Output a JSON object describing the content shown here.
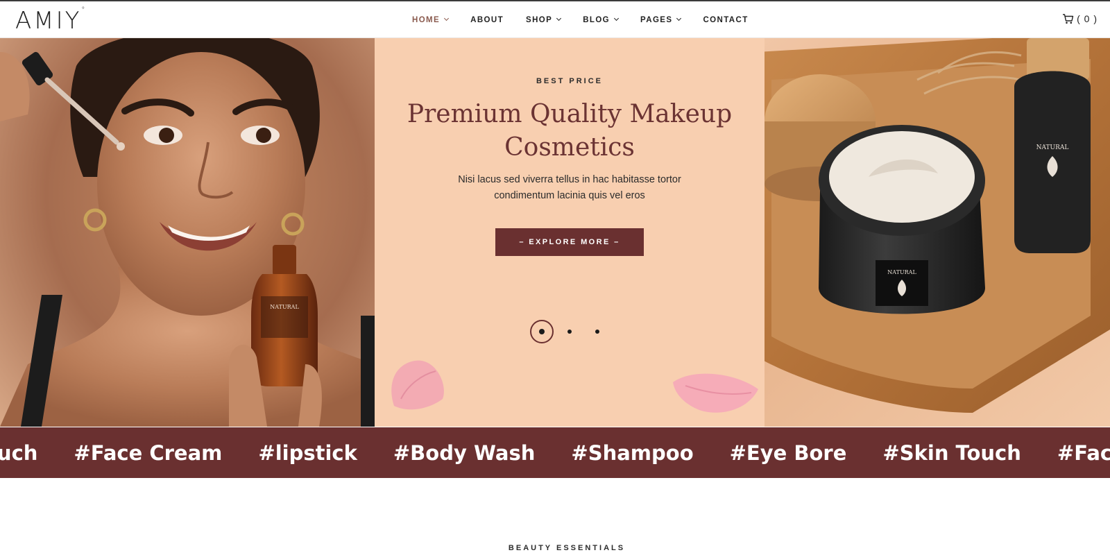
{
  "brand": {
    "logo_text": "AMIY",
    "logo_mark": "°"
  },
  "nav": {
    "items": [
      {
        "label": "HOME",
        "dropdown": true,
        "active": true
      },
      {
        "label": "ABOUT",
        "dropdown": false
      },
      {
        "label": "SHOP",
        "dropdown": true
      },
      {
        "label": "BLOG",
        "dropdown": true
      },
      {
        "label": "PAGES",
        "dropdown": true
      },
      {
        "label": "CONTACT",
        "dropdown": false
      }
    ]
  },
  "cart": {
    "icon": "cart-icon",
    "count_text": "( 0 )"
  },
  "hero": {
    "kicker": "BEST PRICE",
    "headline_line1": "Premium Quality Makeup",
    "headline_line2": "Cosmetics",
    "subtext_line1": "Nisi lacus sed viverra tellus in hac habitasse tortor",
    "subtext_line2": "condimentum lacinia quis vel eros",
    "cta_label": "– EXPLORE MORE –",
    "slides_total": 3,
    "active_slide": 1,
    "left_image": "woman-with-serum-dropper",
    "right_image": "cream-jar-on-wooden-tray",
    "bottle_label": "NATURAL"
  },
  "ticker": {
    "tags": [
      "ouch",
      "#Face Cream",
      "#lipstick",
      "#Body Wash",
      "#Shampoo",
      "#Eye Bore",
      "#Skin Touch",
      "#Face Cream"
    ]
  },
  "section": {
    "kicker": "BEAUTY ESSENTIALS"
  },
  "colors": {
    "accent": "#6a3030",
    "headline": "#6b3333",
    "hero_bg": "#f8cfb0",
    "nav_active": "#8a5a4e"
  }
}
